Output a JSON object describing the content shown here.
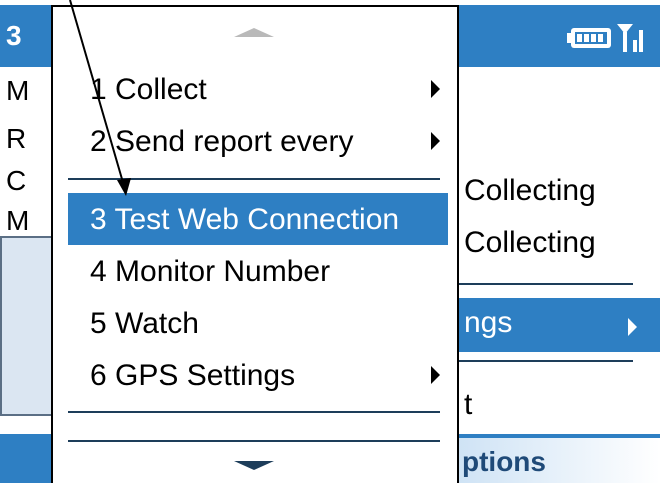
{
  "status_bar": {
    "time_fragment": "3",
    "icons": [
      "battery-icon",
      "signal-icon"
    ]
  },
  "background_left_letters": [
    "M",
    "R",
    "C",
    "M"
  ],
  "options_menu": {
    "items": [
      {
        "label": "Collecting"
      },
      {
        "label": "Collecting"
      },
      {
        "label": "ngs",
        "selected": true,
        "has_submenu": true
      },
      {
        "label": "t"
      }
    ],
    "softkey_label": "ptions"
  },
  "submenu": {
    "items": [
      {
        "label": "1 Collect",
        "has_submenu": true,
        "selected": false
      },
      {
        "label": "2 Send report every",
        "has_submenu": true,
        "selected": false
      },
      {
        "label": "3 Test Web Connection",
        "has_submenu": false,
        "selected": true
      },
      {
        "label": "4 Monitor Number",
        "has_submenu": false,
        "selected": false
      },
      {
        "label": "5 Watch",
        "has_submenu": false,
        "selected": false
      },
      {
        "label": "6 GPS Settings",
        "has_submenu": true,
        "selected": false
      }
    ]
  },
  "colors": {
    "accent": "#2e7fc3",
    "menu_bg": "#ffffff",
    "separator": "#1d3d5a"
  }
}
